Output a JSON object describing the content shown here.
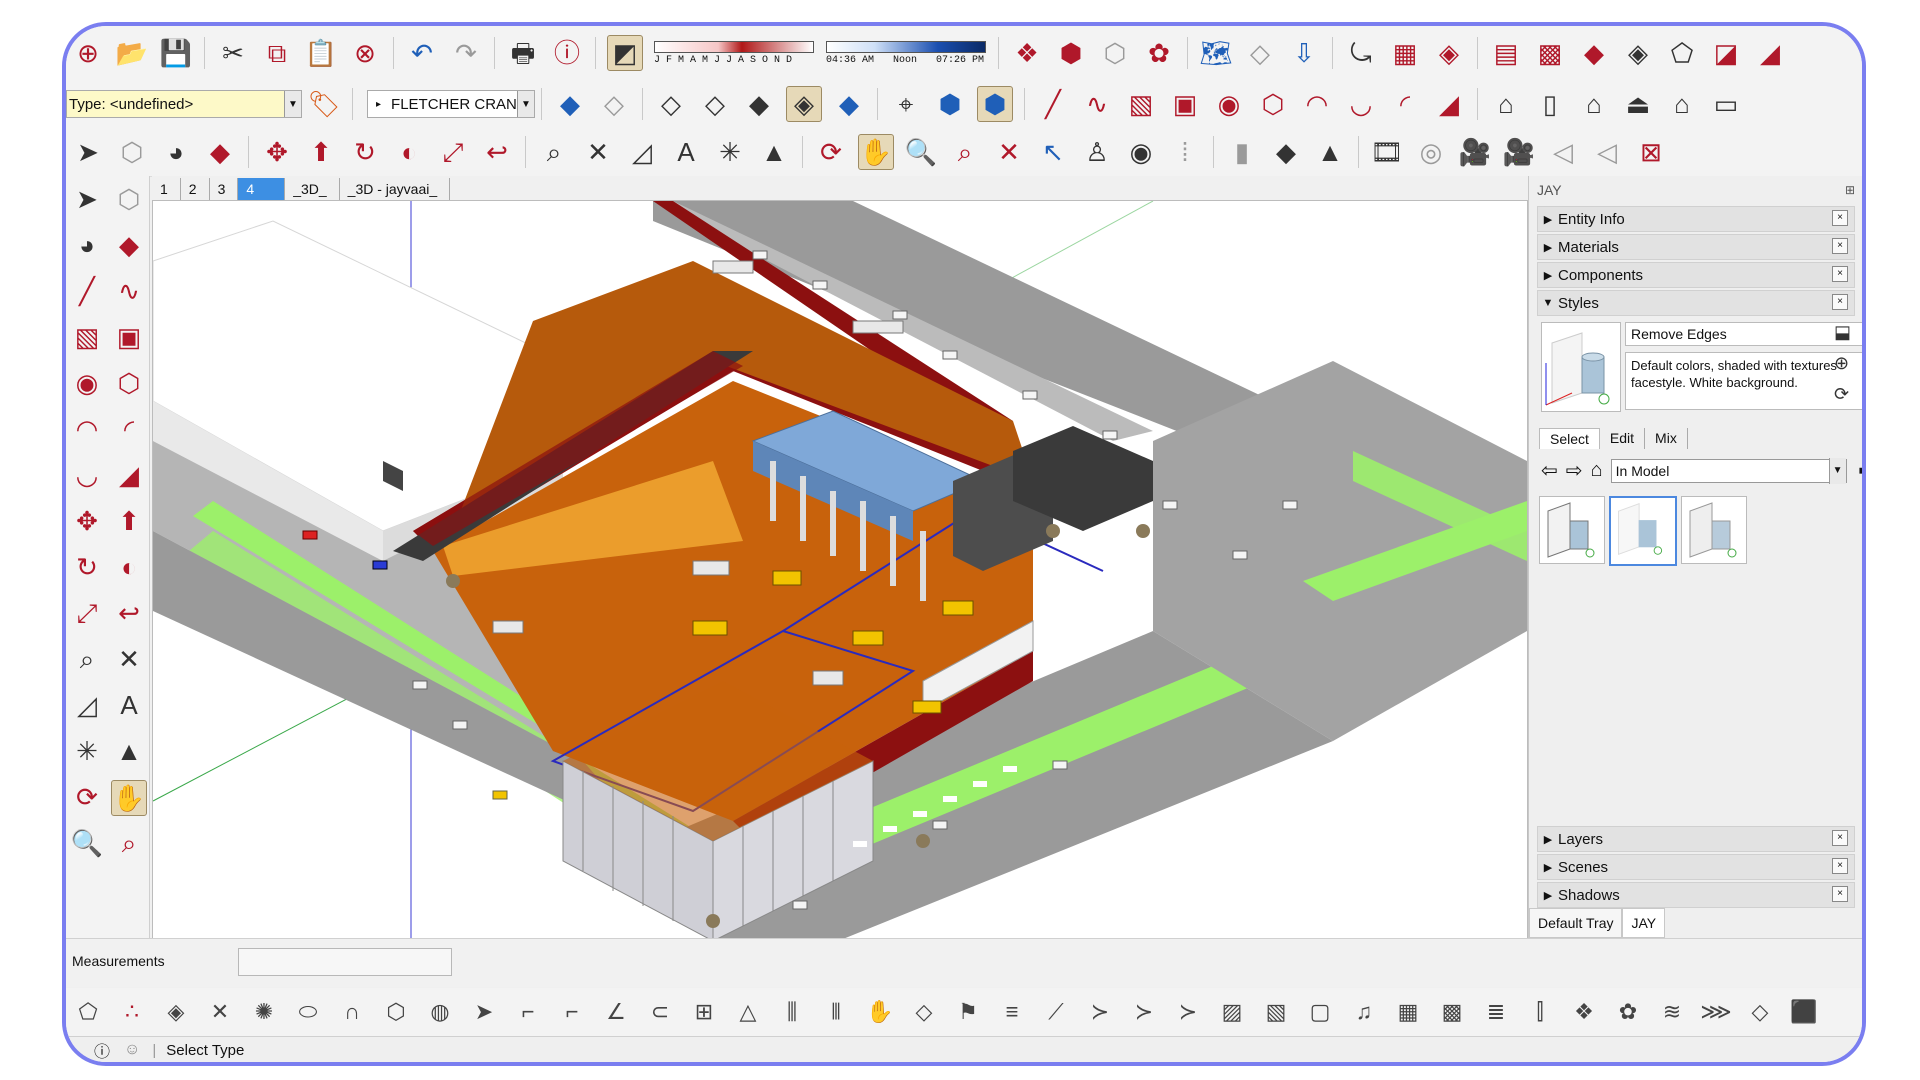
{
  "toolbar": {
    "type_combo_value": "Type: <undefined>",
    "layer_combo_value": "FLETCHER CRAN",
    "shadow_months": "J F M A M J J A S O N D",
    "shadow_time_start": "04:36 AM",
    "shadow_time_noon": "Noon",
    "shadow_time_end": "07:26 PM"
  },
  "scene_tabs": [
    "1",
    "2",
    "3",
    "4",
    "_3D_",
    "_3D - jayvaai_"
  ],
  "active_scene": "4",
  "tray": {
    "title": "JAY",
    "panels_top": [
      {
        "label": "Entity Info",
        "expanded": false
      },
      {
        "label": "Materials",
        "expanded": false
      },
      {
        "label": "Components",
        "expanded": false
      },
      {
        "label": "Styles",
        "expanded": true
      }
    ],
    "styles": {
      "name": "Remove Edges",
      "description": "Default colors, shaded with textures facestyle. White background.",
      "tabs": [
        "Select",
        "Edit",
        "Mix"
      ],
      "active_tab": "Select",
      "collection": "In Model"
    },
    "panels_bottom": [
      {
        "label": "Layers",
        "expanded": false
      },
      {
        "label": "Scenes",
        "expanded": false
      },
      {
        "label": "Shadows",
        "expanded": false
      }
    ],
    "tabs": [
      "Default Tray",
      "JAY"
    ]
  },
  "measurements": {
    "label": "Measurements",
    "value": ""
  },
  "status": {
    "text": "Select Type"
  },
  "colors": {
    "frame_border": "#7a7ef0",
    "excavation": "#c8620c",
    "wall_red": "#8c1010",
    "road": "#9a9a9a",
    "grass": "#9cf06a",
    "tab_active": "#3d8fe3"
  }
}
